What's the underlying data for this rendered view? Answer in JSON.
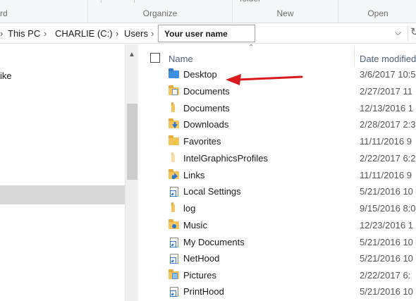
{
  "ribbon": {
    "fragment_left": "rd",
    "fragment_organize": "",
    "fragment_new": "folder",
    "groups": [
      "Organize",
      "New",
      "Open"
    ]
  },
  "address": {
    "crumbs": [
      "This PC",
      "CHARLIE (C:)",
      "Users"
    ],
    "username": "Your user name"
  },
  "navigation": {
    "partial_item": "ike"
  },
  "columns": {
    "name": "Name",
    "date": "Date modified"
  },
  "files": [
    {
      "name": "Desktop",
      "date": "3/6/2017 10:5",
      "icon": "desktop-folder-icon"
    },
    {
      "name": "Documents",
      "date": "2/27/2017 11",
      "icon": "documents-library-icon"
    },
    {
      "name": "Documents",
      "date": "12/13/2016 1",
      "icon": "folder-icon"
    },
    {
      "name": "Downloads",
      "date": "2/28/2017 2:3",
      "icon": "downloads-folder-icon"
    },
    {
      "name": "Favorites",
      "date": "11/11/2016 9",
      "icon": "favorites-folder-icon"
    },
    {
      "name": "IntelGraphicsProfiles",
      "date": "2/22/2017 6:2",
      "icon": "folder-icon"
    },
    {
      "name": "Links",
      "date": "11/11/2016 9",
      "icon": "links-folder-icon"
    },
    {
      "name": "Local Settings",
      "date": "5/21/2016 10",
      "icon": "shortcut-icon"
    },
    {
      "name": "log",
      "date": "9/15/2016 8:0",
      "icon": "folder-icon"
    },
    {
      "name": "Music",
      "date": "12/23/2016 1",
      "icon": "music-folder-icon"
    },
    {
      "name": "My Documents",
      "date": "5/21/2016 10",
      "icon": "shortcut-icon"
    },
    {
      "name": "NetHood",
      "date": "5/21/2016 10",
      "icon": "shortcut-icon"
    },
    {
      "name": "Pictures",
      "date": "2/22/2017 6:",
      "icon": "pictures-folder-icon"
    },
    {
      "name": "PrintHood",
      "date": "5/21/2016 10",
      "icon": "shortcut-icon"
    }
  ],
  "colors": {
    "arrow": "#d9191c",
    "header_text": "#4c607a",
    "nav_selected": "#d9d9d9"
  }
}
